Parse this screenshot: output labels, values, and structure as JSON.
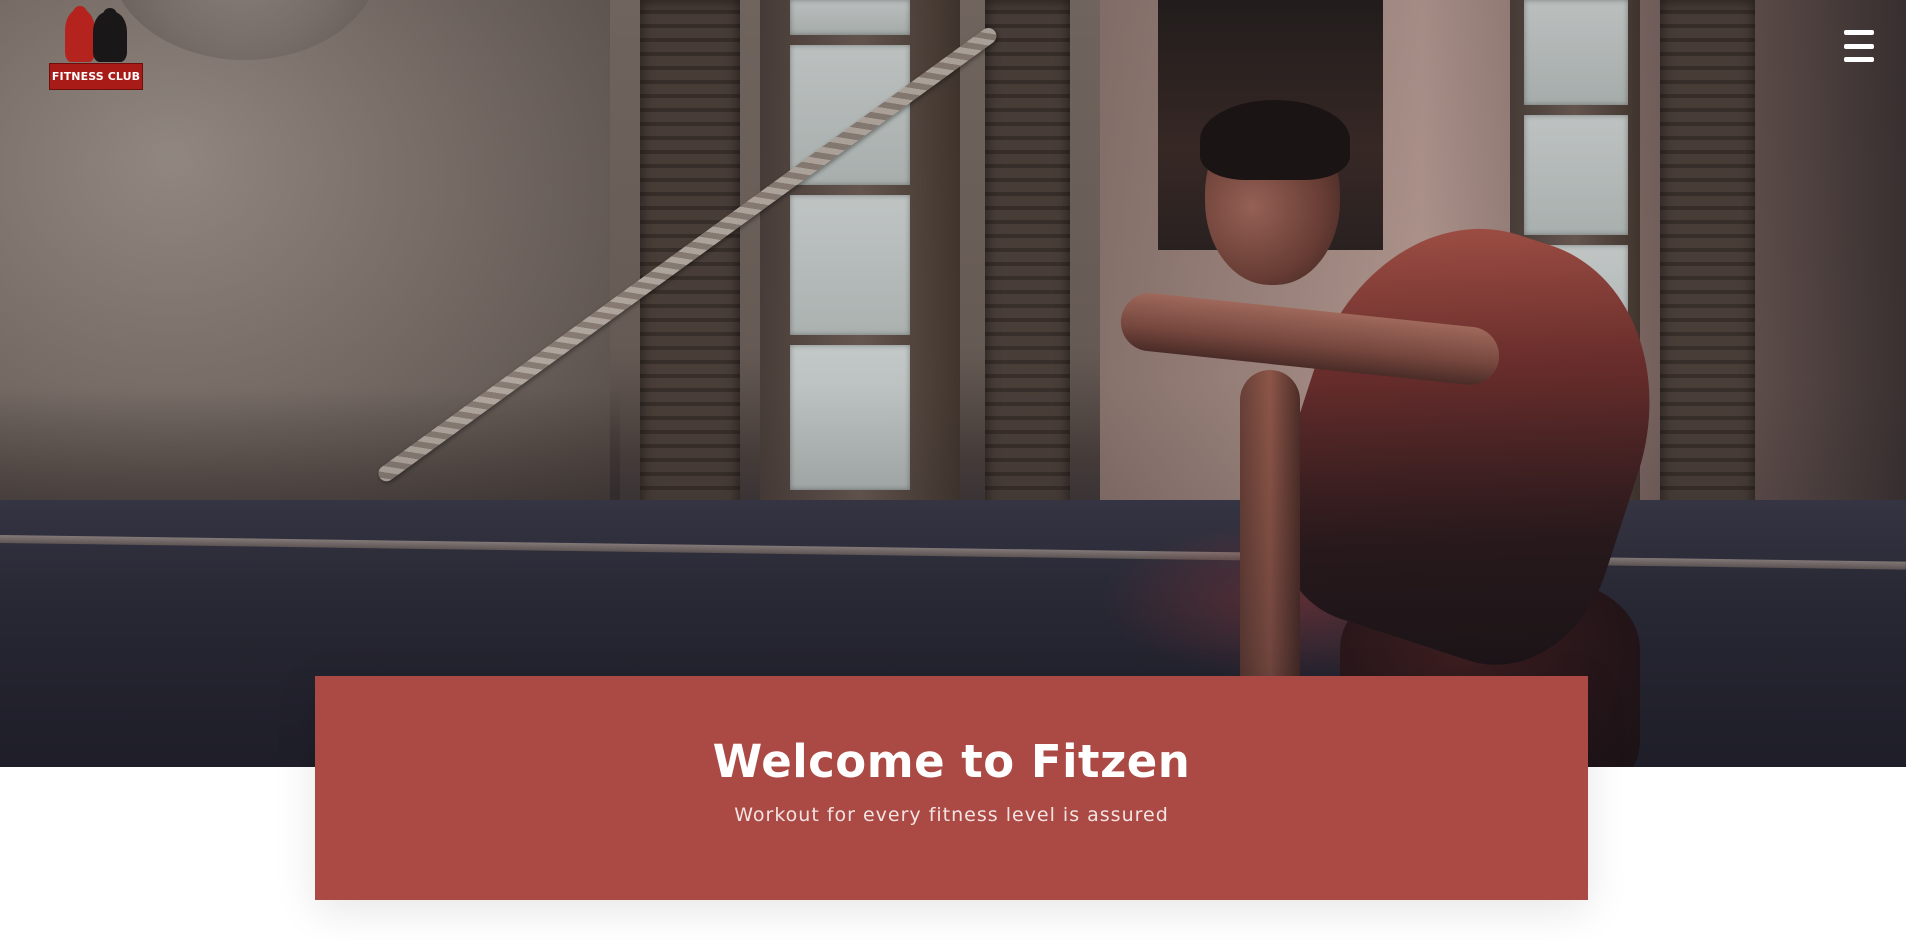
{
  "header": {
    "logo_text": "FITNESS CLUB",
    "menu_icon": "hamburger-menu-icon"
  },
  "hero": {
    "image_subject": "man training with battle ropes in a gym"
  },
  "welcome": {
    "title": "Welcome to Fitzen",
    "subtitle": "Workout for every fitness level is assured"
  },
  "colors": {
    "accent_panel": "#ab4a45",
    "logo_red": "#a81b17",
    "text_on_dark": "#ffffff"
  }
}
